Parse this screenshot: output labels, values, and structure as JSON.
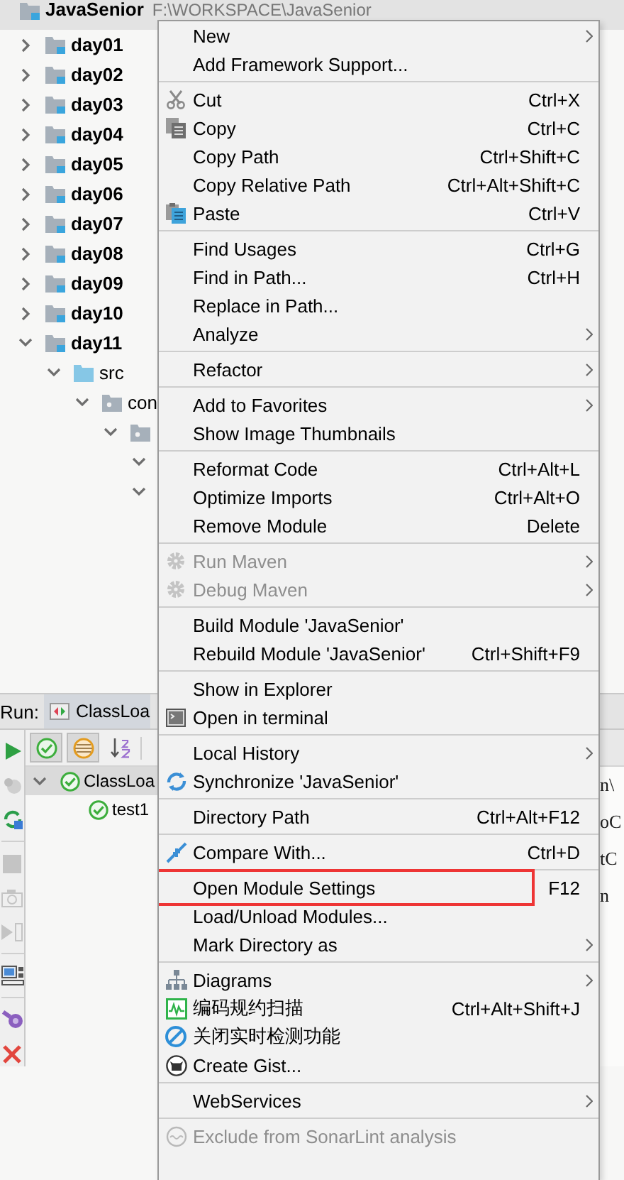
{
  "project": {
    "root": {
      "label": "JavaSenior",
      "path": "F:\\WORKSPACE\\JavaSenior",
      "kind": "module"
    },
    "items": [
      {
        "label": "day01",
        "kind": "module",
        "expanded": false
      },
      {
        "label": "day02",
        "kind": "module",
        "expanded": false
      },
      {
        "label": "day03",
        "kind": "module",
        "expanded": false
      },
      {
        "label": "day04",
        "kind": "module",
        "expanded": false
      },
      {
        "label": "day05",
        "kind": "module",
        "expanded": false
      },
      {
        "label": "day06",
        "kind": "module",
        "expanded": false
      },
      {
        "label": "day07",
        "kind": "module",
        "expanded": false
      },
      {
        "label": "day08",
        "kind": "module",
        "expanded": false
      },
      {
        "label": "day09",
        "kind": "module",
        "expanded": false
      },
      {
        "label": "day10",
        "kind": "module",
        "expanded": false
      },
      {
        "label": "day11",
        "kind": "module",
        "expanded": true,
        "children": [
          {
            "label": "src",
            "kind": "source",
            "expanded": true,
            "children": [
              {
                "label": "con",
                "kind": "package",
                "expanded": true,
                "children": [
                  {
                    "kind": "package",
                    "expanded": true,
                    "children": [
                      {
                        "expanded": true
                      },
                      {
                        "expanded": true
                      }
                    ]
                  }
                ]
              }
            ]
          }
        ]
      }
    ]
  },
  "run": {
    "title": "Run:",
    "tabs": [
      {
        "label": "ClassLoa",
        "selected": true
      }
    ],
    "side_tools": [
      {
        "kind": "play",
        "disabled": false
      },
      {
        "kind": "debug",
        "disabled": true
      },
      {
        "kind": "rerun",
        "disabled": false
      },
      {
        "kind": "separator"
      },
      {
        "kind": "stop",
        "disabled": true
      },
      {
        "kind": "camera",
        "disabled": true
      },
      {
        "kind": "step",
        "disabled": true
      },
      {
        "kind": "separator"
      },
      {
        "kind": "layout",
        "disabled": false
      },
      {
        "kind": "separator"
      },
      {
        "kind": "plugin",
        "disabled": false
      },
      {
        "kind": "close",
        "disabled": false
      }
    ],
    "toolbar": [
      {
        "kind": "passed",
        "selected": true
      },
      {
        "kind": "ignored",
        "selected": true
      },
      {
        "kind": "sort",
        "selected": false
      }
    ],
    "tests": [
      {
        "label": "ClassLoa",
        "kind": "passed",
        "expanded": true,
        "selected": true,
        "children": [
          {
            "label": "test1",
            "kind": "passed",
            "selected": false
          }
        ]
      }
    ],
    "console": [
      {
        "text": "n\\"
      },
      {
        "text": "oC"
      },
      {
        "text": "tC"
      },
      {
        "text": "n"
      }
    ]
  },
  "menu": [
    {
      "kind": "item",
      "label": "New",
      "submenu": true,
      "disabled": false,
      "outlined": false
    },
    {
      "kind": "item",
      "label": "Add Framework Support...",
      "submenu": false,
      "disabled": false,
      "outlined": false
    },
    {
      "kind": "separator"
    },
    {
      "kind": "cut",
      "label": "Cut",
      "shortcut": "Ctrl+X",
      "submenu": false,
      "disabled": false,
      "outlined": false
    },
    {
      "kind": "copy",
      "label": "Copy",
      "shortcut": "Ctrl+C",
      "submenu": false,
      "disabled": false,
      "outlined": false
    },
    {
      "kind": "item",
      "label": "Copy Path",
      "shortcut": "Ctrl+Shift+C",
      "submenu": false,
      "disabled": false,
      "outlined": false
    },
    {
      "kind": "item",
      "label": "Copy Relative Path",
      "shortcut": "Ctrl+Alt+Shift+C",
      "submenu": false,
      "disabled": false,
      "outlined": false
    },
    {
      "kind": "paste",
      "label": "Paste",
      "shortcut": "Ctrl+V",
      "submenu": false,
      "disabled": false,
      "outlined": false
    },
    {
      "kind": "separator"
    },
    {
      "kind": "item",
      "label": "Find Usages",
      "shortcut": "Ctrl+G",
      "submenu": false,
      "disabled": false,
      "outlined": false
    },
    {
      "kind": "item",
      "label": "Find in Path...",
      "shortcut": "Ctrl+H",
      "submenu": false,
      "disabled": false,
      "outlined": false
    },
    {
      "kind": "item",
      "label": "Replace in Path...",
      "submenu": false,
      "disabled": false,
      "outlined": false
    },
    {
      "kind": "item",
      "label": "Analyze",
      "submenu": true,
      "disabled": false,
      "outlined": false
    },
    {
      "kind": "separator"
    },
    {
      "kind": "item",
      "label": "Refactor",
      "submenu": true,
      "disabled": false,
      "outlined": false
    },
    {
      "kind": "separator"
    },
    {
      "kind": "item",
      "label": "Add to Favorites",
      "submenu": true,
      "disabled": false,
      "outlined": false
    },
    {
      "kind": "item",
      "label": "Show Image Thumbnails",
      "submenu": false,
      "disabled": false,
      "outlined": false
    },
    {
      "kind": "separator"
    },
    {
      "kind": "item",
      "label": "Reformat Code",
      "shortcut": "Ctrl+Alt+L",
      "submenu": false,
      "disabled": false,
      "outlined": false
    },
    {
      "kind": "item",
      "label": "Optimize Imports",
      "shortcut": "Ctrl+Alt+O",
      "submenu": false,
      "disabled": false,
      "outlined": false
    },
    {
      "kind": "item",
      "label": "Remove Module",
      "shortcut": "Delete",
      "submenu": false,
      "disabled": false,
      "outlined": false
    },
    {
      "kind": "separator"
    },
    {
      "kind": "gear",
      "label": "Run Maven",
      "submenu": true,
      "disabled": true,
      "outlined": false
    },
    {
      "kind": "gear",
      "label": "Debug Maven",
      "submenu": true,
      "disabled": true,
      "outlined": false
    },
    {
      "kind": "separator"
    },
    {
      "kind": "item",
      "label": "Build Module 'JavaSenior'",
      "submenu": false,
      "disabled": false,
      "outlined": false
    },
    {
      "kind": "item",
      "label": "Rebuild Module 'JavaSenior'",
      "shortcut": "Ctrl+Shift+F9",
      "submenu": false,
      "disabled": false,
      "outlined": false
    },
    {
      "kind": "separator"
    },
    {
      "kind": "item",
      "label": "Show in Explorer",
      "submenu": false,
      "disabled": false,
      "outlined": false
    },
    {
      "kind": "terminal",
      "label": "Open in terminal",
      "submenu": false,
      "disabled": false,
      "outlined": false
    },
    {
      "kind": "separator"
    },
    {
      "kind": "item",
      "label": "Local History",
      "submenu": true,
      "disabled": false,
      "outlined": false
    },
    {
      "kind": "sync",
      "label": "Synchronize 'JavaSenior'",
      "submenu": false,
      "disabled": false,
      "outlined": false
    },
    {
      "kind": "separator"
    },
    {
      "kind": "item",
      "label": "Directory Path",
      "shortcut": "Ctrl+Alt+F12",
      "submenu": false,
      "disabled": false,
      "outlined": false
    },
    {
      "kind": "separator"
    },
    {
      "kind": "compare",
      "label": "Compare With...",
      "shortcut": "Ctrl+D",
      "submenu": false,
      "disabled": false,
      "outlined": false
    },
    {
      "kind": "separator"
    },
    {
      "kind": "item",
      "label": "Open Module Settings",
      "shortcut": "F12",
      "submenu": false,
      "disabled": false,
      "outlined": true
    },
    {
      "kind": "item",
      "label": "Load/Unload Modules...",
      "submenu": false,
      "disabled": false,
      "outlined": false
    },
    {
      "kind": "item",
      "label": "Mark Directory as",
      "submenu": true,
      "disabled": false,
      "outlined": false
    },
    {
      "kind": "separator"
    },
    {
      "kind": "diagram",
      "label": "Diagrams",
      "submenu": true,
      "disabled": false,
      "outlined": false
    },
    {
      "kind": "scan",
      "label": "编码规约扫描",
      "shortcut": "Ctrl+Alt+Shift+J",
      "submenu": false,
      "disabled": false,
      "outlined": false
    },
    {
      "kind": "ban",
      "label": "关闭实时检测功能",
      "submenu": false,
      "disabled": false,
      "outlined": false
    },
    {
      "kind": "github",
      "label": "Create Gist...",
      "submenu": false,
      "disabled": false,
      "outlined": false
    },
    {
      "kind": "separator"
    },
    {
      "kind": "item",
      "label": "WebServices",
      "submenu": true,
      "disabled": false,
      "outlined": false
    },
    {
      "kind": "separator"
    },
    {
      "kind": "sonar",
      "label": "Exclude from SonarLint analysis",
      "submenu": false,
      "disabled": true,
      "outlined": false
    }
  ]
}
